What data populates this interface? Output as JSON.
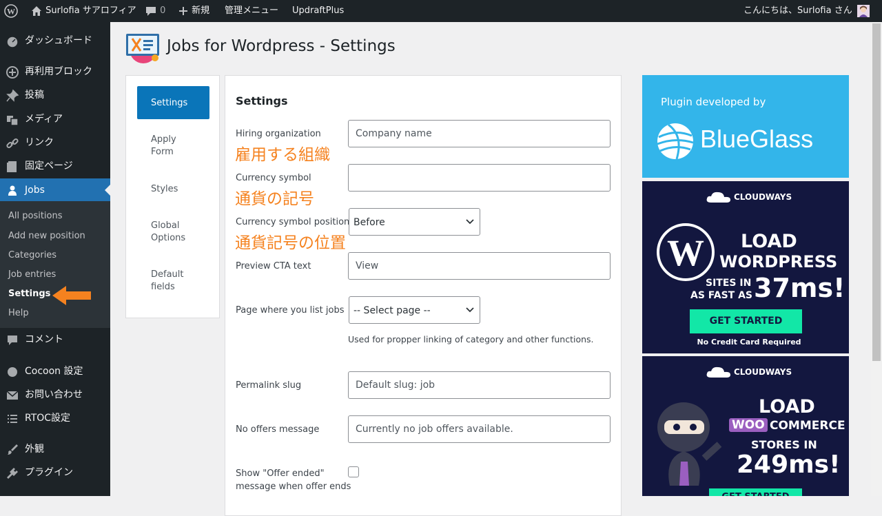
{
  "admin_bar": {
    "site_name": "Surlofia サアロフィア",
    "comments_count": "0",
    "new_label": "新規",
    "admin_menu_label": "管理メニュー",
    "updraft_label": "UpdraftPlus",
    "greeting": "こんにちは、Surlofia さん"
  },
  "sidebar": {
    "items": [
      {
        "label": "ダッシュボード",
        "icon": "dashboard-icon"
      },
      {
        "label": "再利用ブロック",
        "icon": "plus-circle-icon"
      },
      {
        "label": "投稿",
        "icon": "pin-icon"
      },
      {
        "label": "メディア",
        "icon": "media-icon"
      },
      {
        "label": "リンク",
        "icon": "link-icon"
      },
      {
        "label": "固定ページ",
        "icon": "page-icon"
      },
      {
        "label": "Jobs",
        "icon": "person-icon"
      },
      {
        "label": "コメント",
        "icon": "comment-icon"
      },
      {
        "label": "Cocoon 設定",
        "icon": "circle-icon"
      },
      {
        "label": "お問い合わせ",
        "icon": "mail-icon"
      },
      {
        "label": "RTOC設定",
        "icon": "list-icon"
      },
      {
        "label": "外観",
        "icon": "brush-icon"
      },
      {
        "label": "プラグイン",
        "icon": "plugin-icon"
      }
    ],
    "submenu": [
      "All positions",
      "Add new position",
      "Categories",
      "Job entries",
      "Settings",
      "Help"
    ]
  },
  "page": {
    "title": "Jobs for Wordpress - Settings"
  },
  "tabs": [
    "Settings",
    "Apply Form",
    "Styles",
    "Global Options",
    "Default fields"
  ],
  "settings": {
    "heading": "Settings",
    "hiring_org_label": "Hiring organization",
    "hiring_org_placeholder": "Company name",
    "hiring_org_jp": "雇用する組織",
    "currency_label": "Currency symbol",
    "currency_value": "",
    "currency_jp": "通貨の記号",
    "currency_pos_label": "Currency symbol position",
    "currency_pos_value": "Before",
    "currency_pos_jp": "通貨記号の位置",
    "preview_cta_label": "Preview CTA text",
    "preview_cta_placeholder": "View",
    "page_list_label": "Page where you list jobs",
    "page_list_value": "-- Select page --",
    "page_list_help": "Used for propper linking of category and other functions.",
    "permalink_label": "Permalink slug",
    "permalink_placeholder": "Default slug: job",
    "no_offers_label": "No offers message",
    "no_offers_placeholder": "Currently no job offers available.",
    "offer_ended_label_1": "Show \"Offer ended\"",
    "offer_ended_label_2": "message when offer ends"
  },
  "ads": {
    "blueglass_top": "Plugin developed by",
    "blueglass_brand": "BlueGlass",
    "cloudways_brand": "CLOUDWAYS",
    "ad1_line1": "LOAD",
    "ad1_line2": "WORDPRESS",
    "ad1_line3": "SITES IN",
    "ad1_line4": "AS FAST AS",
    "ad1_big": "37ms!",
    "ad1_cta": "GET STARTED",
    "ad1_note": "No Credit Card Required",
    "ad2_line1": "LOAD",
    "ad2_woo": "WOO",
    "ad2_commerce": "COMMERCE",
    "ad2_line3": "STORES IN",
    "ad2_big": "249ms!",
    "ad2_cta": "GET STARTED"
  },
  "colors": {
    "accent": "#2271b1",
    "annotation": "#f5821f",
    "blueglass_bg": "#33b5ea",
    "cloudways_bg": "#13173f",
    "cta_green": "#12e7a7"
  }
}
